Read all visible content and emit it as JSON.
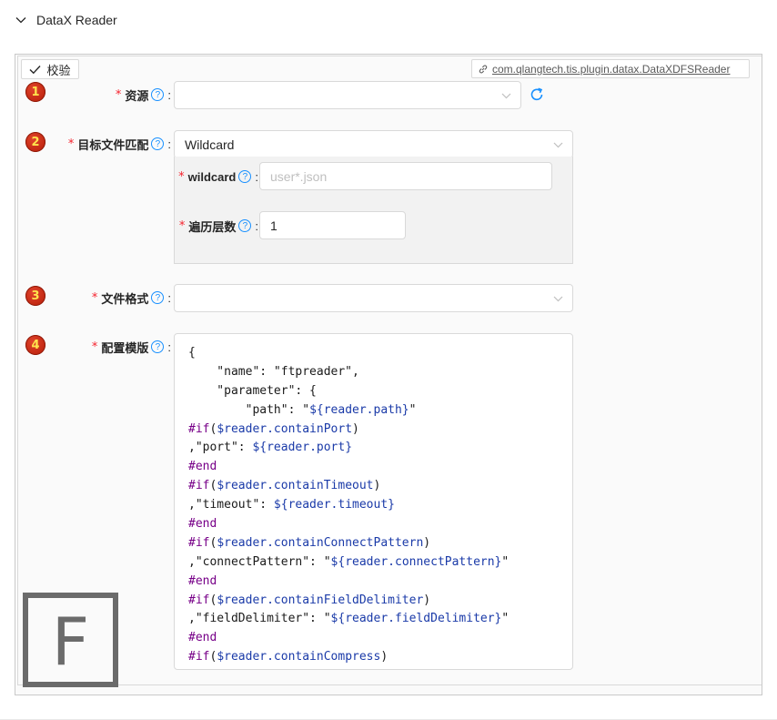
{
  "header": {
    "title": "DataX Reader"
  },
  "toolbar": {
    "verify_label": "校验",
    "plugin_class": "com.qlangtech.tis.plugin.datax.DataXDFSReader"
  },
  "fields": [
    {
      "step": "1",
      "label": "资源",
      "value": "",
      "placeholder": ""
    },
    {
      "step": "2",
      "label": "目标文件匹配",
      "value": "Wildcard"
    },
    {
      "step": "3",
      "label": "文件格式",
      "value": ""
    },
    {
      "step": "4",
      "label": "配置模版"
    }
  ],
  "sub_fields": {
    "wildcard": {
      "label": "wildcard",
      "placeholder": "user*.json",
      "value": ""
    },
    "depth": {
      "label": "遍历层数",
      "value": "1"
    }
  },
  "code_lines": [
    [
      {
        "t": "{",
        "c": "str"
      }
    ],
    [
      {
        "t": "    \"name\": \"ftpreader\",",
        "c": "str"
      }
    ],
    [
      {
        "t": "    \"parameter\": {",
        "c": "str"
      }
    ],
    [
      {
        "t": "        \"path\": \"",
        "c": "str"
      },
      {
        "t": "${reader.path}",
        "c": "var"
      },
      {
        "t": "\"",
        "c": "str"
      }
    ],
    [
      {
        "t": "#if",
        "c": "dir"
      },
      {
        "t": "(",
        "c": "str"
      },
      {
        "t": "$reader.containPort",
        "c": "var"
      },
      {
        "t": ")",
        "c": "str"
      }
    ],
    [
      {
        "t": ",\"port\": ",
        "c": "str"
      },
      {
        "t": "${reader.port}",
        "c": "var"
      }
    ],
    [
      {
        "t": "#end",
        "c": "dir"
      }
    ],
    [
      {
        "t": "#if",
        "c": "dir"
      },
      {
        "t": "(",
        "c": "str"
      },
      {
        "t": "$reader.containTimeout",
        "c": "var"
      },
      {
        "t": ")",
        "c": "str"
      }
    ],
    [
      {
        "t": ",\"timeout\": ",
        "c": "str"
      },
      {
        "t": "${reader.timeout}",
        "c": "var"
      }
    ],
    [
      {
        "t": "#end",
        "c": "dir"
      }
    ],
    [
      {
        "t": "#if",
        "c": "dir"
      },
      {
        "t": "(",
        "c": "str"
      },
      {
        "t": "$reader.containConnectPattern",
        "c": "var"
      },
      {
        "t": ")",
        "c": "str"
      }
    ],
    [
      {
        "t": ",\"connectPattern\": \"",
        "c": "str"
      },
      {
        "t": "${reader.connectPattern}",
        "c": "var"
      },
      {
        "t": "\"",
        "c": "str"
      }
    ],
    [
      {
        "t": "#end",
        "c": "dir"
      }
    ],
    [
      {
        "t": "#if",
        "c": "dir"
      },
      {
        "t": "(",
        "c": "str"
      },
      {
        "t": "$reader.containFieldDelimiter",
        "c": "var"
      },
      {
        "t": ")",
        "c": "str"
      }
    ],
    [
      {
        "t": ",\"fieldDelimiter\": \"",
        "c": "str"
      },
      {
        "t": "${reader.fieldDelimiter}",
        "c": "var"
      },
      {
        "t": "\"",
        "c": "str"
      }
    ],
    [
      {
        "t": "#end",
        "c": "dir"
      }
    ],
    [
      {
        "t": "#if",
        "c": "dir"
      },
      {
        "t": "(",
        "c": "str"
      },
      {
        "t": "$reader.containCompress",
        "c": "var"
      },
      {
        "t": ")",
        "c": "str"
      }
    ]
  ],
  "watermark": {
    "letter": "F"
  },
  "colors": {
    "required": "#f5222d",
    "help": "#1890ff",
    "step_badge": "#c8260d"
  }
}
